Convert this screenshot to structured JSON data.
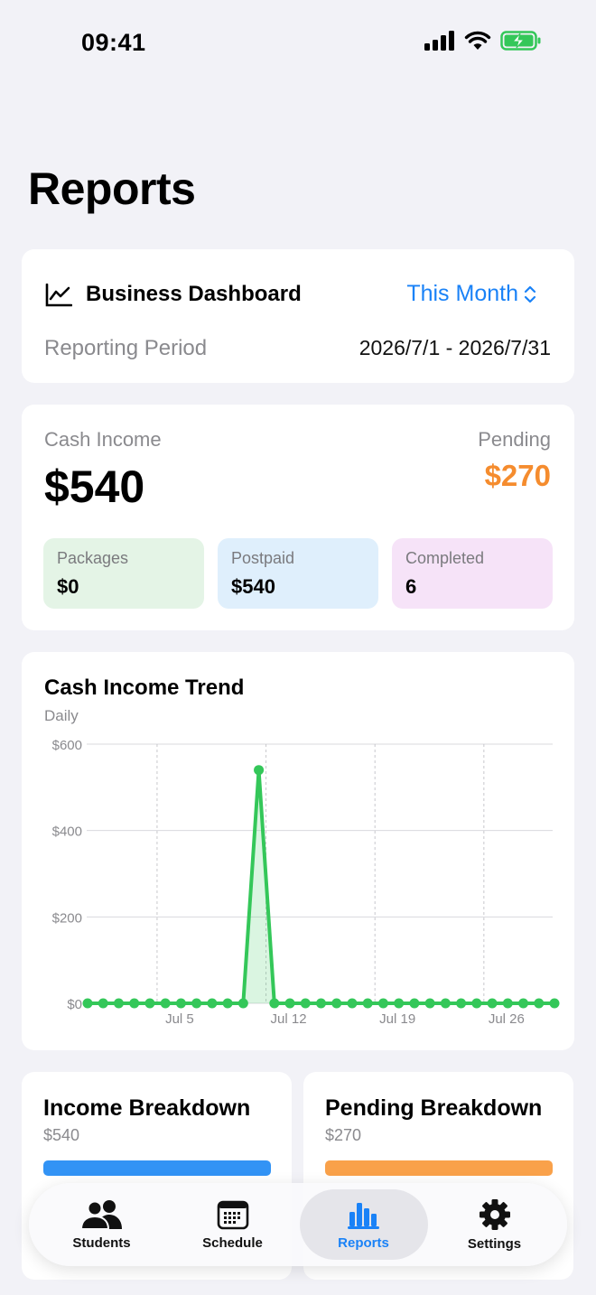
{
  "status": {
    "time": "09:41"
  },
  "page": {
    "title": "Reports"
  },
  "dashboard": {
    "title": "Business Dashboard",
    "period_select": "This Month",
    "period_label": "Reporting Period",
    "period_value": "2026/7/1 - 2026/7/31"
  },
  "income": {
    "cash_label": "Cash Income",
    "cash_value": "$540",
    "pending_label": "Pending",
    "pending_value": "$270",
    "tiles": [
      {
        "label": "Packages",
        "value": "$0"
      },
      {
        "label": "Postpaid",
        "value": "$540"
      },
      {
        "label": "Completed",
        "value": "6"
      }
    ]
  },
  "chart": {
    "title": "Cash Income Trend",
    "subtitle": "Daily"
  },
  "chart_data": {
    "type": "area",
    "title": "Cash Income Trend",
    "subtitle": "Daily",
    "x": [
      1,
      2,
      3,
      4,
      5,
      6,
      7,
      8,
      9,
      10,
      11,
      12,
      13,
      14,
      15,
      16,
      17,
      18,
      19,
      20,
      21,
      22,
      23,
      24,
      25,
      26,
      27,
      28,
      29,
      30,
      31
    ],
    "values": [
      0,
      0,
      0,
      0,
      0,
      0,
      0,
      0,
      0,
      0,
      0,
      540,
      0,
      0,
      0,
      0,
      0,
      0,
      0,
      0,
      0,
      0,
      0,
      0,
      0,
      0,
      0,
      0,
      0,
      0,
      0
    ],
    "ylim": [
      0,
      600
    ],
    "yticks": [
      "$0",
      "$200",
      "$400",
      "$600"
    ],
    "xticks": [
      {
        "day": 5,
        "label": "Jul 5"
      },
      {
        "day": 12,
        "label": "Jul 12"
      },
      {
        "day": 19,
        "label": "Jul 19"
      },
      {
        "day": 26,
        "label": "Jul 26"
      }
    ],
    "color": "#34c759",
    "grid": true
  },
  "breakdown": {
    "income": {
      "title": "Income Breakdown",
      "amount": "$540",
      "color": "#3293f5"
    },
    "pending": {
      "title": "Pending Breakdown",
      "amount": "$270",
      "color": "#f9a14a"
    }
  },
  "tabs": [
    {
      "label": "Students",
      "icon": "people-icon"
    },
    {
      "label": "Schedule",
      "icon": "calendar-icon"
    },
    {
      "label": "Reports",
      "icon": "bar-chart-icon",
      "active": true
    },
    {
      "label": "Settings",
      "icon": "gear-icon"
    }
  ],
  "colors": {
    "accent": "#1a82f7",
    "pending": "#f58c2e",
    "chart": "#34c759"
  }
}
